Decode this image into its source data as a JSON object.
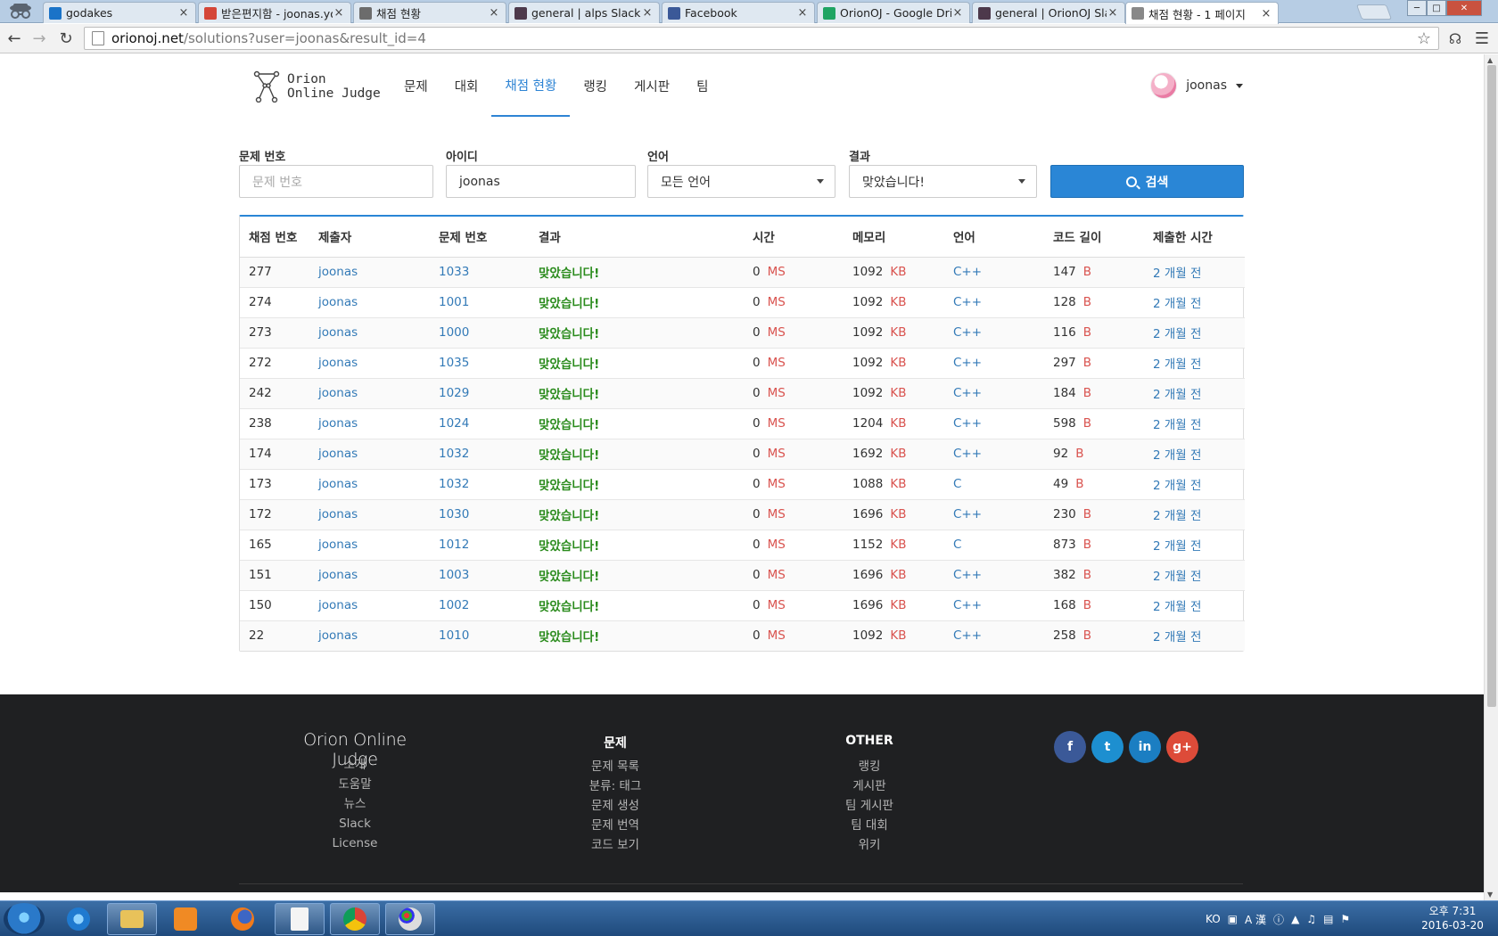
{
  "browser": {
    "tabs": [
      {
        "title": "godakes",
        "favicon": "eye-icon",
        "color": "#1a73c8"
      },
      {
        "title": "받은편지함 - joonas.yoo",
        "favicon": "gmail-icon",
        "color": "#d44638"
      },
      {
        "title": "채점 현황",
        "favicon": "chrome-page-icon",
        "color": "#6c6c6c"
      },
      {
        "title": "general | alps Slack",
        "favicon": "slack-hash-icon",
        "color": "#4d394b"
      },
      {
        "title": "Facebook",
        "favicon": "facebook-icon",
        "color": "#3b5998"
      },
      {
        "title": "OrionOJ - Google Drive",
        "favicon": "drive-icon",
        "color": "#1fa463"
      },
      {
        "title": "general | OrionOJ Slack",
        "favicon": "slack-hash-icon",
        "color": "#4d394b"
      },
      {
        "title": "채점 현황 - 1 페이지",
        "favicon": "page-icon",
        "color": "#888888"
      }
    ],
    "url_host": "orionoj.net",
    "url_path": "/solutions?user=joonas&result_id=4"
  },
  "nav": {
    "logo_line1": "Orion",
    "logo_line2": "Online Judge",
    "menu": [
      "문제",
      "대회",
      "채점 현황",
      "랭킹",
      "게시판",
      "팀"
    ],
    "active_menu": "채점 현황",
    "username": "joonas"
  },
  "form": {
    "problem_label": "문제 번호",
    "problem_placeholder": "문제 번호",
    "id_label": "아이디",
    "id_value": "joonas",
    "lang_label": "언어",
    "lang_value": "모든 언어",
    "result_label": "결과",
    "result_value": "맞았습니다!",
    "search_label": "검색"
  },
  "table": {
    "headers": [
      "채점 번호",
      "제출자",
      "문제 번호",
      "결과",
      "시간",
      "메모리",
      "언어",
      "코드 길이",
      "제출한 시간"
    ],
    "time_unit": "MS",
    "memory_unit": "KB",
    "length_unit": "B",
    "rows": [
      {
        "id": "277",
        "user": "joonas",
        "problem": "1033",
        "result": "맞았습니다!",
        "time": "0",
        "memory": "1092",
        "lang": "C++",
        "length": "147",
        "submitted": "2 개월 전"
      },
      {
        "id": "274",
        "user": "joonas",
        "problem": "1001",
        "result": "맞았습니다!",
        "time": "0",
        "memory": "1092",
        "lang": "C++",
        "length": "128",
        "submitted": "2 개월 전"
      },
      {
        "id": "273",
        "user": "joonas",
        "problem": "1000",
        "result": "맞았습니다!",
        "time": "0",
        "memory": "1092",
        "lang": "C++",
        "length": "116",
        "submitted": "2 개월 전"
      },
      {
        "id": "272",
        "user": "joonas",
        "problem": "1035",
        "result": "맞았습니다!",
        "time": "0",
        "memory": "1092",
        "lang": "C++",
        "length": "297",
        "submitted": "2 개월 전"
      },
      {
        "id": "242",
        "user": "joonas",
        "problem": "1029",
        "result": "맞았습니다!",
        "time": "0",
        "memory": "1092",
        "lang": "C++",
        "length": "184",
        "submitted": "2 개월 전"
      },
      {
        "id": "238",
        "user": "joonas",
        "problem": "1024",
        "result": "맞았습니다!",
        "time": "0",
        "memory": "1204",
        "lang": "C++",
        "length": "598",
        "submitted": "2 개월 전"
      },
      {
        "id": "174",
        "user": "joonas",
        "problem": "1032",
        "result": "맞았습니다!",
        "time": "0",
        "memory": "1692",
        "lang": "C++",
        "length": "92",
        "submitted": "2 개월 전"
      },
      {
        "id": "173",
        "user": "joonas",
        "problem": "1032",
        "result": "맞았습니다!",
        "time": "0",
        "memory": "1088",
        "lang": "C",
        "length": "49",
        "submitted": "2 개월 전"
      },
      {
        "id": "172",
        "user": "joonas",
        "problem": "1030",
        "result": "맞았습니다!",
        "time": "0",
        "memory": "1696",
        "lang": "C++",
        "length": "230",
        "submitted": "2 개월 전"
      },
      {
        "id": "165",
        "user": "joonas",
        "problem": "1012",
        "result": "맞았습니다!",
        "time": "0",
        "memory": "1152",
        "lang": "C",
        "length": "873",
        "submitted": "2 개월 전"
      },
      {
        "id": "151",
        "user": "joonas",
        "problem": "1003",
        "result": "맞았습니다!",
        "time": "0",
        "memory": "1696",
        "lang": "C++",
        "length": "382",
        "submitted": "2 개월 전"
      },
      {
        "id": "150",
        "user": "joonas",
        "problem": "1002",
        "result": "맞았습니다!",
        "time": "0",
        "memory": "1696",
        "lang": "C++",
        "length": "168",
        "submitted": "2 개월 전"
      },
      {
        "id": "22",
        "user": "joonas",
        "problem": "1010",
        "result": "맞았습니다!",
        "time": "0",
        "memory": "1092",
        "lang": "C++",
        "length": "258",
        "submitted": "2 개월 전"
      }
    ]
  },
  "footer": {
    "brand": "Orion Online Judge",
    "col1_links": [
      "소개",
      "도움말",
      "뉴스",
      "Slack",
      "License"
    ],
    "col2_title": "문제",
    "col2_links": [
      "문제 목록",
      "분류: 태그",
      "문제 생성",
      "문제 번역",
      "코드 보기"
    ],
    "col3_title": "OTHER",
    "col3_links": [
      "랭킹",
      "게시판",
      "팀 게시판",
      "팀 대회",
      "위키"
    ],
    "social": [
      {
        "name": "facebook-icon",
        "glyph": "f",
        "color": "#3b5998"
      },
      {
        "name": "twitter-icon",
        "glyph": "t",
        "color": "#1d8fd0"
      },
      {
        "name": "linkedin-icon",
        "glyph": "in",
        "color": "#1b7ec2"
      },
      {
        "name": "google-plus-icon",
        "glyph": "g+",
        "color": "#dd4b39"
      }
    ]
  },
  "taskbar": {
    "lang_indicator": "KO",
    "time": "오후 7:31",
    "date": "2016-03-20"
  },
  "colors": {
    "accent": "#2a86d6",
    "link": "#337ab7",
    "success": "#2a8b1c",
    "unit": "#d9534f",
    "footer_bg": "#1f2022"
  }
}
